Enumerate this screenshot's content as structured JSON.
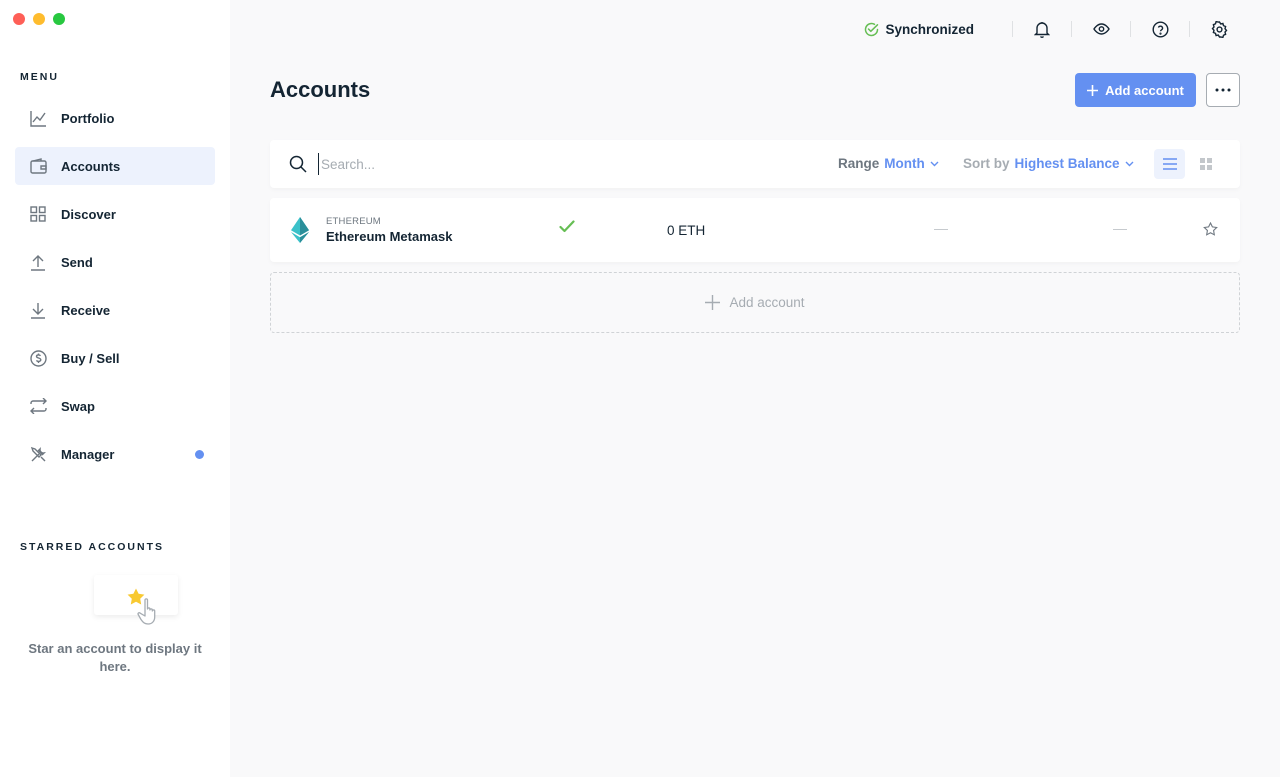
{
  "sidebar": {
    "menu_title": "MENU",
    "items": [
      {
        "label": "Portfolio",
        "icon": "chart-line-icon"
      },
      {
        "label": "Accounts",
        "icon": "wallet-icon",
        "active": true
      },
      {
        "label": "Discover",
        "icon": "apps-grid-icon"
      },
      {
        "label": "Send",
        "icon": "arrow-up-icon"
      },
      {
        "label": "Receive",
        "icon": "arrow-down-icon"
      },
      {
        "label": "Buy / Sell",
        "icon": "dollar-coin-icon"
      },
      {
        "label": "Swap",
        "icon": "swap-arrows-icon"
      },
      {
        "label": "Manager",
        "icon": "tools-icon",
        "has_notification": true
      }
    ],
    "starred_title": "STARRED ACCOUNTS",
    "starred_empty_text": "Star an account to display it here."
  },
  "topbar": {
    "sync_status": "Synchronized",
    "icons": [
      "bell-icon",
      "eye-icon",
      "help-icon",
      "settings-icon"
    ]
  },
  "main": {
    "title": "Accounts",
    "add_account_label": "Add account",
    "search_placeholder": "Search...",
    "range_label": "Range",
    "range_value": "Month",
    "sort_label": "Sort by",
    "sort_value": "Highest Balance",
    "accounts": [
      {
        "currency": "ETHEREUM",
        "name": "Ethereum Metamask",
        "balance": "0 ETH",
        "countervalue": "—",
        "variation": "—",
        "synced": true,
        "starred": false
      }
    ],
    "add_account_placeholder": "Add account"
  },
  "colors": {
    "accent": "#6490f1",
    "success": "#66be54",
    "text": "#142533",
    "muted": "#6e7780"
  }
}
